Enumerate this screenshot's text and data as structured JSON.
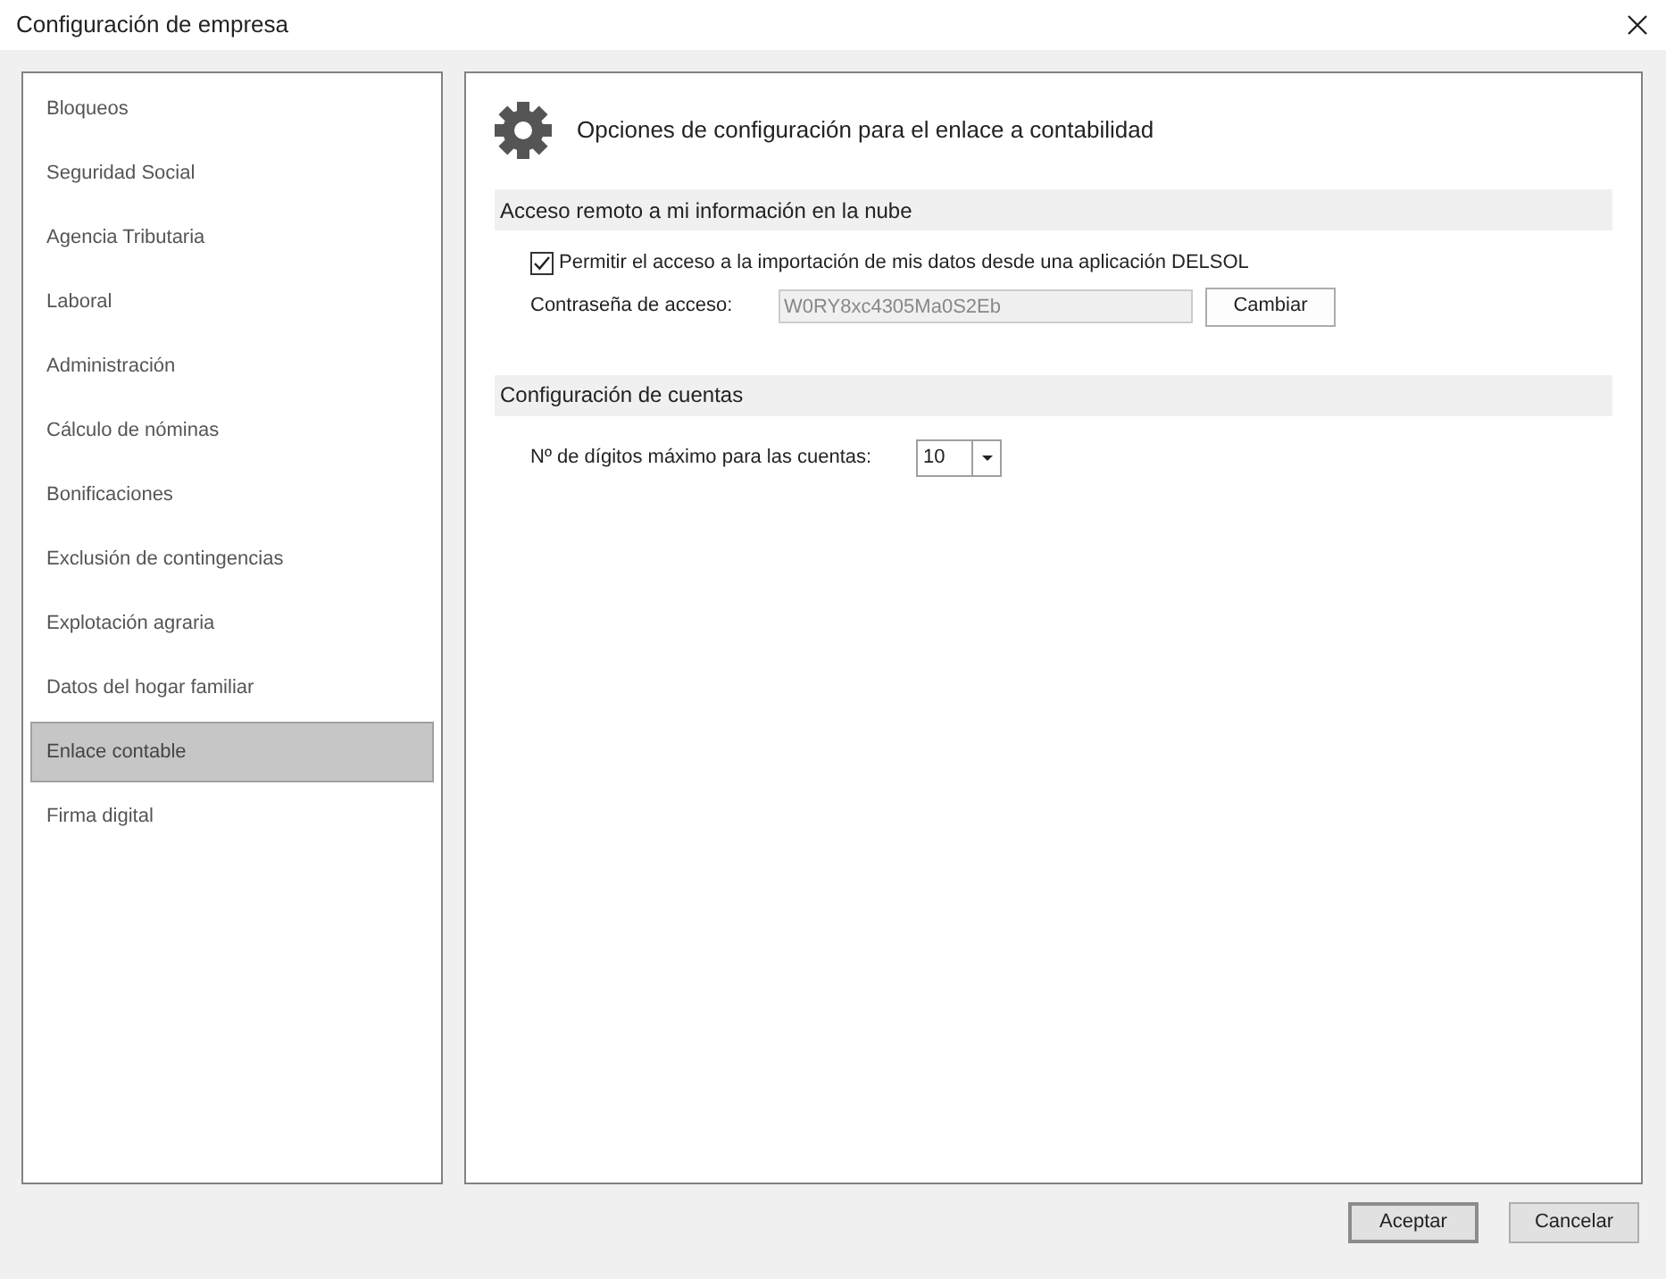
{
  "window": {
    "title": "Configuración de empresa"
  },
  "sidebar": {
    "items": [
      {
        "label": "Bloqueos",
        "selected": false
      },
      {
        "label": "Seguridad Social",
        "selected": false
      },
      {
        "label": "Agencia Tributaria",
        "selected": false
      },
      {
        "label": "Laboral",
        "selected": false
      },
      {
        "label": "Administración",
        "selected": false
      },
      {
        "label": "Cálculo de nóminas",
        "selected": false
      },
      {
        "label": "Bonificaciones",
        "selected": false
      },
      {
        "label": "Exclusión de contingencias",
        "selected": false
      },
      {
        "label": "Explotación agraria",
        "selected": false
      },
      {
        "label": "Datos del hogar familiar",
        "selected": false
      },
      {
        "label": "Enlace contable",
        "selected": true
      },
      {
        "label": "Firma digital",
        "selected": false
      }
    ]
  },
  "panel": {
    "title": "Opciones de configuración para el enlace a contabilidad",
    "sections": [
      {
        "header": "Acceso remoto a mi información en la nube",
        "checkbox": {
          "label": "Permitir el acceso a la importación de mis datos desde una aplicación DELSOL",
          "checked": true
        },
        "password": {
          "label": "Contraseña de acceso:",
          "value": "W0RY8xc4305Ma0S2Eb",
          "disabled": true,
          "button": "Cambiar"
        }
      },
      {
        "header": "Configuración de cuentas",
        "select": {
          "label": "Nº de dígitos máximo para las cuentas:",
          "value": "10"
        }
      }
    ]
  },
  "buttons": [
    "Aceptar",
    "Cancelar"
  ]
}
